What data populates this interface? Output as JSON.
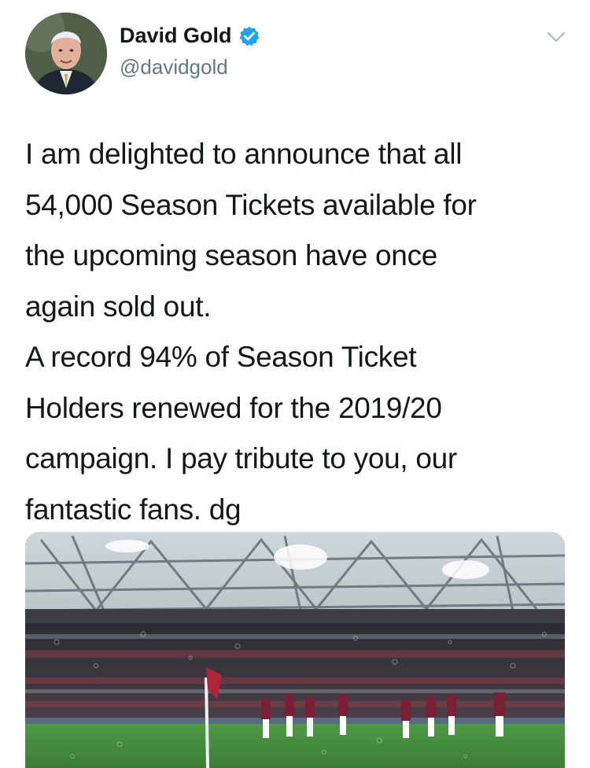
{
  "tweet": {
    "display_name": "David Gold",
    "handle": "@davidgold",
    "verified": true,
    "text": "I am delighted to announce that all\n54,000 Season Tickets available for\nthe upcoming season have once\nagain sold out.\nA record 94% of Season Ticket\nHolders renewed for the 2019/20\ncampaign. I pay tribute to you, our\nfantastic fans. dg"
  },
  "icons": {
    "verified": "verified-badge-icon",
    "more": "chevron-down-icon"
  },
  "colors": {
    "verified_blue": "#1da1f2",
    "text": "#14171a",
    "secondary": "#657786",
    "pitch": "#3f8a3a"
  }
}
